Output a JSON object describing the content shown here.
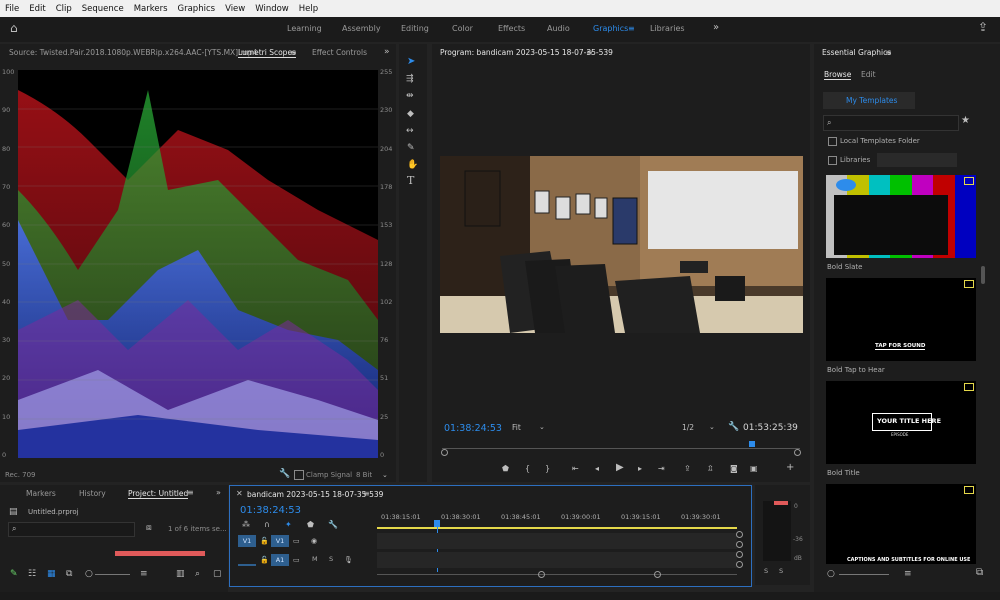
{
  "menu": [
    "File",
    "Edit",
    "Clip",
    "Sequence",
    "Markers",
    "Graphics",
    "View",
    "Window",
    "Help"
  ],
  "workspaces": [
    "Learning",
    "Assembly",
    "Editing",
    "Color",
    "Effects",
    "Audio",
    "Graphics",
    "Libraries"
  ],
  "workspace_active": "Graphics",
  "source_panel": {
    "tab_source": "Source: Twisted.Pair.2018.1080p.WEBRip.x264.AAC-[YTS.MX].mp4",
    "tab_scopes": "Lumetri Scopes",
    "tab_effects": "Effect Controls",
    "left_scale": [
      "100",
      "90",
      "80",
      "70",
      "60",
      "50",
      "40",
      "30",
      "20",
      "10",
      "0"
    ],
    "right_scale": [
      "255",
      "230",
      "204",
      "178",
      "153",
      "128",
      "102",
      "76",
      "51",
      "25",
      "0"
    ],
    "footer_left": "Rec. 709",
    "clamp_signal": "Clamp Signal",
    "bit_depth": "8 Bit"
  },
  "program": {
    "title": "Program: bandicam 2023-05-15 18-07-35-539",
    "timecode_current": "01:38:24:53",
    "fit": "Fit",
    "resolution": "1/2",
    "timecode_duration": "01:53:25:39"
  },
  "essential_graphics": {
    "title": "Essential Graphics",
    "tab_browse": "Browse",
    "tab_edit": "Edit",
    "my_templates": "My Templates",
    "local_templates": "Local Templates Folder",
    "libraries": "Libraries",
    "templates": [
      {
        "name": "Bold Slate",
        "overlay": ""
      },
      {
        "name": "Bold Tap to Hear",
        "overlay": "TAP FOR SOUND"
      },
      {
        "name": "Bold Title",
        "overlay": "YOUR TITLE HERE",
        "sub": "EPISODE"
      },
      {
        "name": "",
        "overlay": "CAPTIONS AND SUBTITLES FOR ONLINE USE"
      }
    ]
  },
  "project": {
    "tab_markers": "Markers",
    "tab_history": "History",
    "tab_project": "Project: Untitled",
    "file": "Untitled.prproj",
    "items_count": "1 of 6 items se..."
  },
  "timeline": {
    "title": "bandicam 2023-05-15 18-07-35-539",
    "timecode": "01:38:24:53",
    "ruler": [
      "01:38:15:01",
      "01:38:30:01",
      "01:38:45:01",
      "01:39:00:01",
      "01:39:15:01",
      "01:39:30:01"
    ],
    "tracks": [
      {
        "target": "V1",
        "name": "V1"
      },
      {
        "target": "",
        "name": "A1"
      }
    ],
    "audio_labels": [
      "M",
      "S"
    ]
  },
  "meter": {
    "scale": [
      "0",
      "-36",
      "dB"
    ],
    "solo": [
      "S",
      "S"
    ]
  },
  "colors": {
    "accent": "#2d8ceb",
    "panel": "#1d1d1d",
    "bg": "#232323",
    "playhead": "#2d8ceb",
    "work_area": "#e5d84a"
  }
}
